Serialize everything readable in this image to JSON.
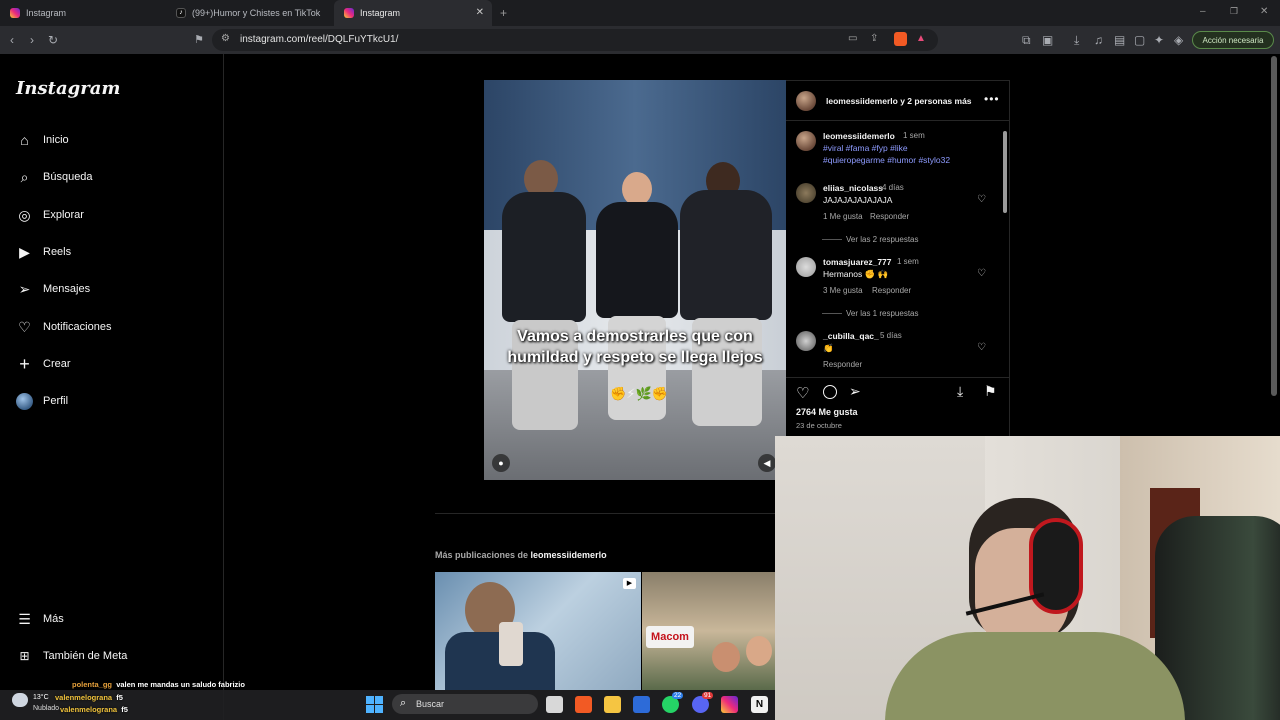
{
  "browser": {
    "tabs": [
      {
        "label": "Instagram",
        "active": false
      },
      {
        "label": "(99+)Humor y Chistes en TikTok | Tik",
        "active": false
      },
      {
        "label": "Instagram",
        "active": true
      }
    ],
    "url": "instagram.com/reel/DQLFuYTkcU1/",
    "action_button": "Acción necesaria"
  },
  "sidebar": {
    "logo": "Instagram",
    "items": [
      {
        "label": "Inicio",
        "icon": "home-icon"
      },
      {
        "label": "Búsqueda",
        "icon": "search-icon"
      },
      {
        "label": "Explorar",
        "icon": "compass-icon"
      },
      {
        "label": "Reels",
        "icon": "reels-icon"
      },
      {
        "label": "Mensajes",
        "icon": "send-icon"
      },
      {
        "label": "Notificaciones",
        "icon": "heart-icon"
      },
      {
        "label": "Crear",
        "icon": "plus-icon"
      },
      {
        "label": "Perfil",
        "icon": "avatar-icon"
      }
    ],
    "bottom_items": [
      {
        "label": "Más",
        "icon": "menu-icon"
      },
      {
        "label": "También de Meta",
        "icon": "meta-icon"
      }
    ]
  },
  "post": {
    "header": {
      "owner": "leomessiidemerlo",
      "collab_suffix": "y 2 personas más"
    },
    "caption_overlay": "Vamos a demostrarles que con humildad y respeto se llega llejos",
    "caption_emojis": "✊⚡🌿✊",
    "caption": {
      "user": "leomessiidemerlo",
      "time": "1 sem",
      "hashtags_line1": "#viral #fama #fyp #like",
      "hashtags_line2": "#quieropegarme #humor #stylo32"
    },
    "comments": [
      {
        "user": "eliias_nicolass",
        "time": "4 días",
        "text": "JAJAJAJAJAJAJA",
        "likes": "1 Me gusta",
        "reply": "Responder",
        "view_replies": "Ver las 2 respuestas"
      },
      {
        "user": "tomasjuarez_777",
        "time": "1 sem",
        "text": "Hermanos ✊ 🙌",
        "likes": "3 Me gusta",
        "reply": "Responder",
        "view_replies": "Ver las 1 respuestas"
      },
      {
        "user": "_cubilla_qac_",
        "time": "5 días",
        "text": "👏",
        "reply": "Responder"
      }
    ],
    "like_count": "2764 Me gusta",
    "date": "23 de octubre"
  },
  "more_posts": {
    "prefix": "Más publicaciones de ",
    "user": "leomessiidemerlo",
    "thumb2_label": "Macom"
  },
  "taskbar": {
    "weather_temp": "13°C",
    "weather_desc": "Nublado",
    "search_placeholder": "Buscar",
    "whatsapp_badge": "22",
    "discord_badge": "91",
    "chat": [
      {
        "user": "polenta_gg",
        "text": "valen me mandas un saludo fabrizio"
      },
      {
        "user": "valenmelograna",
        "text": "f5"
      },
      {
        "user": "valenmelograna",
        "text": "f5"
      }
    ]
  },
  "colors": {
    "accent_link": "#8e9bff",
    "bg": "#000000",
    "border": "#262626"
  }
}
